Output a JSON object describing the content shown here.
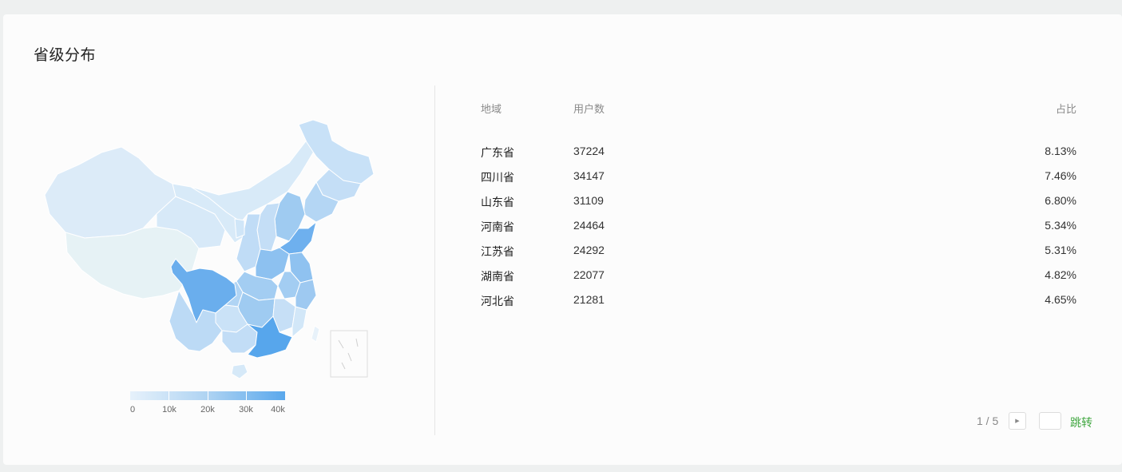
{
  "section": {
    "title": "省级分布"
  },
  "legend": {
    "labels": [
      "0",
      "10k",
      "20k",
      "30k",
      "40k"
    ]
  },
  "colors": {
    "accent": "#5aa8ec",
    "light": "#e6f1fb",
    "link": "#3fa63f"
  },
  "table": {
    "headers": {
      "region": "地域",
      "users": "用户数",
      "ratio": "占比"
    },
    "rows": [
      {
        "region": "广东省",
        "users": "37224",
        "ratio": "8.13%"
      },
      {
        "region": "四川省",
        "users": "34147",
        "ratio": "7.46%"
      },
      {
        "region": "山东省",
        "users": "31109",
        "ratio": "6.80%"
      },
      {
        "region": "河南省",
        "users": "24464",
        "ratio": "5.34%"
      },
      {
        "region": "江苏省",
        "users": "24292",
        "ratio": "5.31%"
      },
      {
        "region": "湖南省",
        "users": "22077",
        "ratio": "4.82%"
      },
      {
        "region": "河北省",
        "users": "21281",
        "ratio": "4.65%"
      }
    ]
  },
  "pagination": {
    "current": "1 / 5",
    "jump_label": "跳转",
    "next_icon": "caret-right-icon"
  }
}
